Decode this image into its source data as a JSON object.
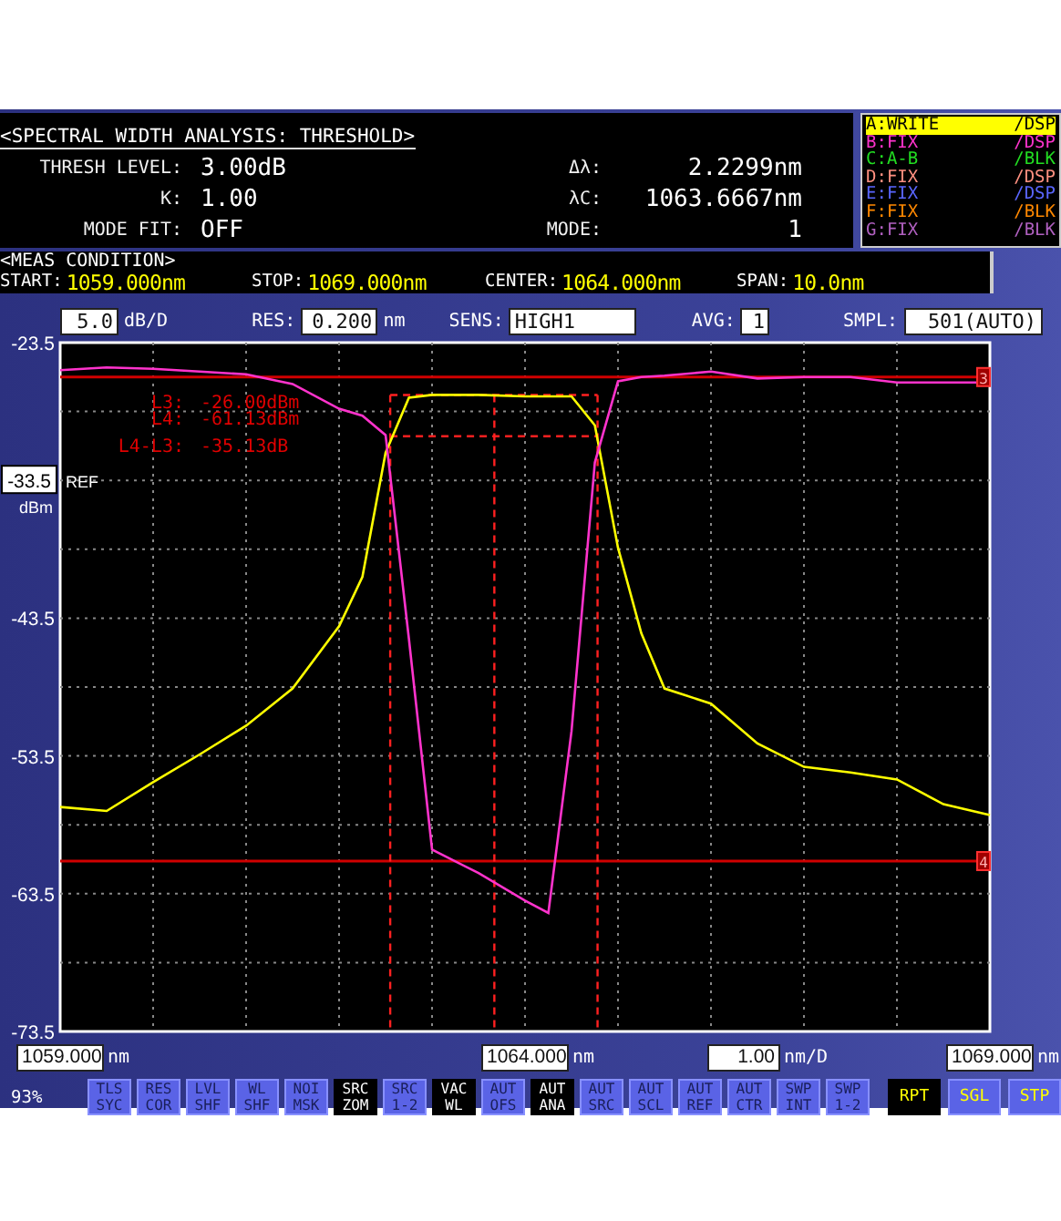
{
  "analysis": {
    "title": "<SPECTRAL WIDTH ANALYSIS: THRESHOLD>",
    "rows": [
      {
        "label": "THRESH LEVEL:",
        "value": "3.00dB",
        "result_label": "Δλ:",
        "result_value": "2.2299nm"
      },
      {
        "label": "K:",
        "value": "1.00",
        "result_label": "λC:",
        "result_value": "1063.6667nm"
      },
      {
        "label": "MODE FIT:",
        "value": "OFF",
        "result_label": "MODE:",
        "result_value": "1"
      }
    ]
  },
  "traces": [
    {
      "name": "A:WRITE",
      "mode": "/DSP",
      "color": "#ffff00",
      "selected": true
    },
    {
      "name": "B:FIX",
      "mode": "/DSP",
      "color": "#ff33cc",
      "selected": false
    },
    {
      "name": "C:A-B",
      "mode": "/BLK",
      "color": "#22dd22",
      "selected": false
    },
    {
      "name": "D:FIX",
      "mode": "/DSP",
      "color": "#ff9080",
      "selected": false
    },
    {
      "name": "E:FIX",
      "mode": "/DSP",
      "color": "#5a66ff",
      "selected": false
    },
    {
      "name": "F:FIX",
      "mode": "/BLK",
      "color": "#ff8800",
      "selected": false
    },
    {
      "name": "G:FIX",
      "mode": "/BLK",
      "color": "#b060c0",
      "selected": false
    }
  ],
  "meas_condition": {
    "title": "<MEAS CONDITION>",
    "items": [
      {
        "label": "START:",
        "value": "1059.000nm"
      },
      {
        "label": "STOP:",
        "value": "1069.000nm"
      },
      {
        "label": "CENTER:",
        "value": "1064.000nm"
      },
      {
        "label": "SPAN:",
        "value": "10.0nm"
      }
    ]
  },
  "settings": [
    {
      "value": "5.0",
      "unit": "dB/D"
    },
    {
      "label": "RES:",
      "value": "0.200",
      "unit": "nm"
    },
    {
      "label": "SENS:",
      "value": "HIGH1"
    },
    {
      "label": "AVG:",
      "value": "1"
    },
    {
      "label": "SMPL:",
      "value": "501(AUTO)"
    }
  ],
  "ref_level": {
    "value": "-33.5",
    "tag": "REF",
    "unit": "dBm"
  },
  "readouts": [
    {
      "label": "L3:",
      "value": "-26.00dBm",
      "tag": "3"
    },
    {
      "label": "L4:",
      "value": "-61.13dBm",
      "tag": "4"
    },
    {
      "label": "L4-L3:",
      "value": "-35.13dB"
    }
  ],
  "chart": {
    "chart_data": {
      "type": "line",
      "x": [
        1059,
        1059.5,
        1060,
        1060.5,
        1061,
        1061.5,
        1062,
        1062.25,
        1062.5,
        1062.75,
        1063,
        1063.5,
        1064,
        1064.25,
        1064.5,
        1064.75,
        1065,
        1065.25,
        1065.5,
        1066,
        1066.5,
        1067,
        1067.5,
        1068,
        1068.5,
        1069
      ],
      "series": [
        {
          "color": "#ffff00",
          "values": [
            -57.2,
            -57.5,
            -55.4,
            -53.4,
            -51.3,
            -48.6,
            -44.1,
            -40.5,
            -31.5,
            -27.5,
            -27.3,
            -27.3,
            -27.4,
            -27.4,
            -27.4,
            -29.5,
            -38.4,
            -44.6,
            -48.6,
            -49.7,
            -52.6,
            -54.3,
            -54.7,
            -55.2,
            -57,
            -57.8
          ]
        },
        {
          "color": "#ff33cc",
          "values": [
            -25.5,
            -25.3,
            -25.4,
            -25.6,
            -25.8,
            -26.5,
            -28.3,
            -28.8,
            -30.2,
            -45,
            -60.3,
            -62,
            -64,
            -64.9,
            -51.7,
            -32.2,
            -26.3,
            -26,
            -25.9,
            -25.6,
            -26.1,
            -26,
            -26,
            -26.4,
            -26.4,
            -26.4
          ]
        }
      ],
      "xlim": [
        1059,
        1069
      ],
      "ylim": [
        -73.5,
        -23.5
      ],
      "grid": true,
      "ref_lines": [
        {
          "axis": "y",
          "value": -26.0
        },
        {
          "axis": "y",
          "value": -61.13
        },
        {
          "axis": "x",
          "value": 1062.55
        },
        {
          "axis": "x",
          "value": 1063.67
        },
        {
          "axis": "x",
          "value": 1064.78
        },
        {
          "axis": "y",
          "value": -27.3
        },
        {
          "axis": "y",
          "value": -30.3
        }
      ],
      "xticks": [
        {
          "value": 1059,
          "label": "1059.000"
        },
        {
          "value": 1064,
          "label": "1064.000"
        },
        {
          "value": 1069,
          "label": "1069.000"
        }
      ],
      "yticks": [
        {
          "value": -23.5,
          "label": "-23.5"
        },
        {
          "value": -43.5,
          "label": "-43.5"
        },
        {
          "value": -53.5,
          "label": "-53.5"
        },
        {
          "value": -63.5,
          "label": "-63.5"
        },
        {
          "value": -73.5,
          "label": "-73.5"
        }
      ]
    }
  },
  "x_units": [
    "nm",
    "nm",
    "nm"
  ],
  "x_scale": {
    "value": "1.00",
    "unit": "nm/D"
  },
  "status": {
    "text": "93%"
  },
  "function_keys": [
    {
      "lines": [
        "TLS",
        "SYC"
      ],
      "on": false
    },
    {
      "lines": [
        "RES",
        "COR"
      ],
      "on": false
    },
    {
      "lines": [
        "LVL",
        "SHF"
      ],
      "on": false
    },
    {
      "lines": [
        "WL",
        "SHF"
      ],
      "on": false
    },
    {
      "lines": [
        "NOI",
        "MSK"
      ],
      "on": false
    },
    {
      "lines": [
        "SRC",
        "ZOM"
      ],
      "on": true
    },
    {
      "lines": [
        "SRC",
        "1-2"
      ],
      "on": false
    },
    {
      "lines": [
        "VAC",
        "WL"
      ],
      "on": true
    },
    {
      "lines": [
        "AUT",
        "OFS"
      ],
      "on": false
    },
    {
      "lines": [
        "AUT",
        "ANA"
      ],
      "on": true
    },
    {
      "lines": [
        "AUT",
        "SRC"
      ],
      "on": false
    },
    {
      "lines": [
        "AUT",
        "SCL"
      ],
      "on": false
    },
    {
      "lines": [
        "AUT",
        "REF"
      ],
      "on": false
    },
    {
      "lines": [
        "AUT",
        "CTR"
      ],
      "on": false
    },
    {
      "lines": [
        "SWP",
        "INT"
      ],
      "on": false
    },
    {
      "lines": [
        "SWP",
        "1-2"
      ],
      "on": false
    }
  ],
  "sweep_keys": [
    {
      "label": "RPT",
      "selected": true
    },
    {
      "label": "SGL",
      "selected": false
    },
    {
      "label": "STP",
      "selected": false
    }
  ]
}
